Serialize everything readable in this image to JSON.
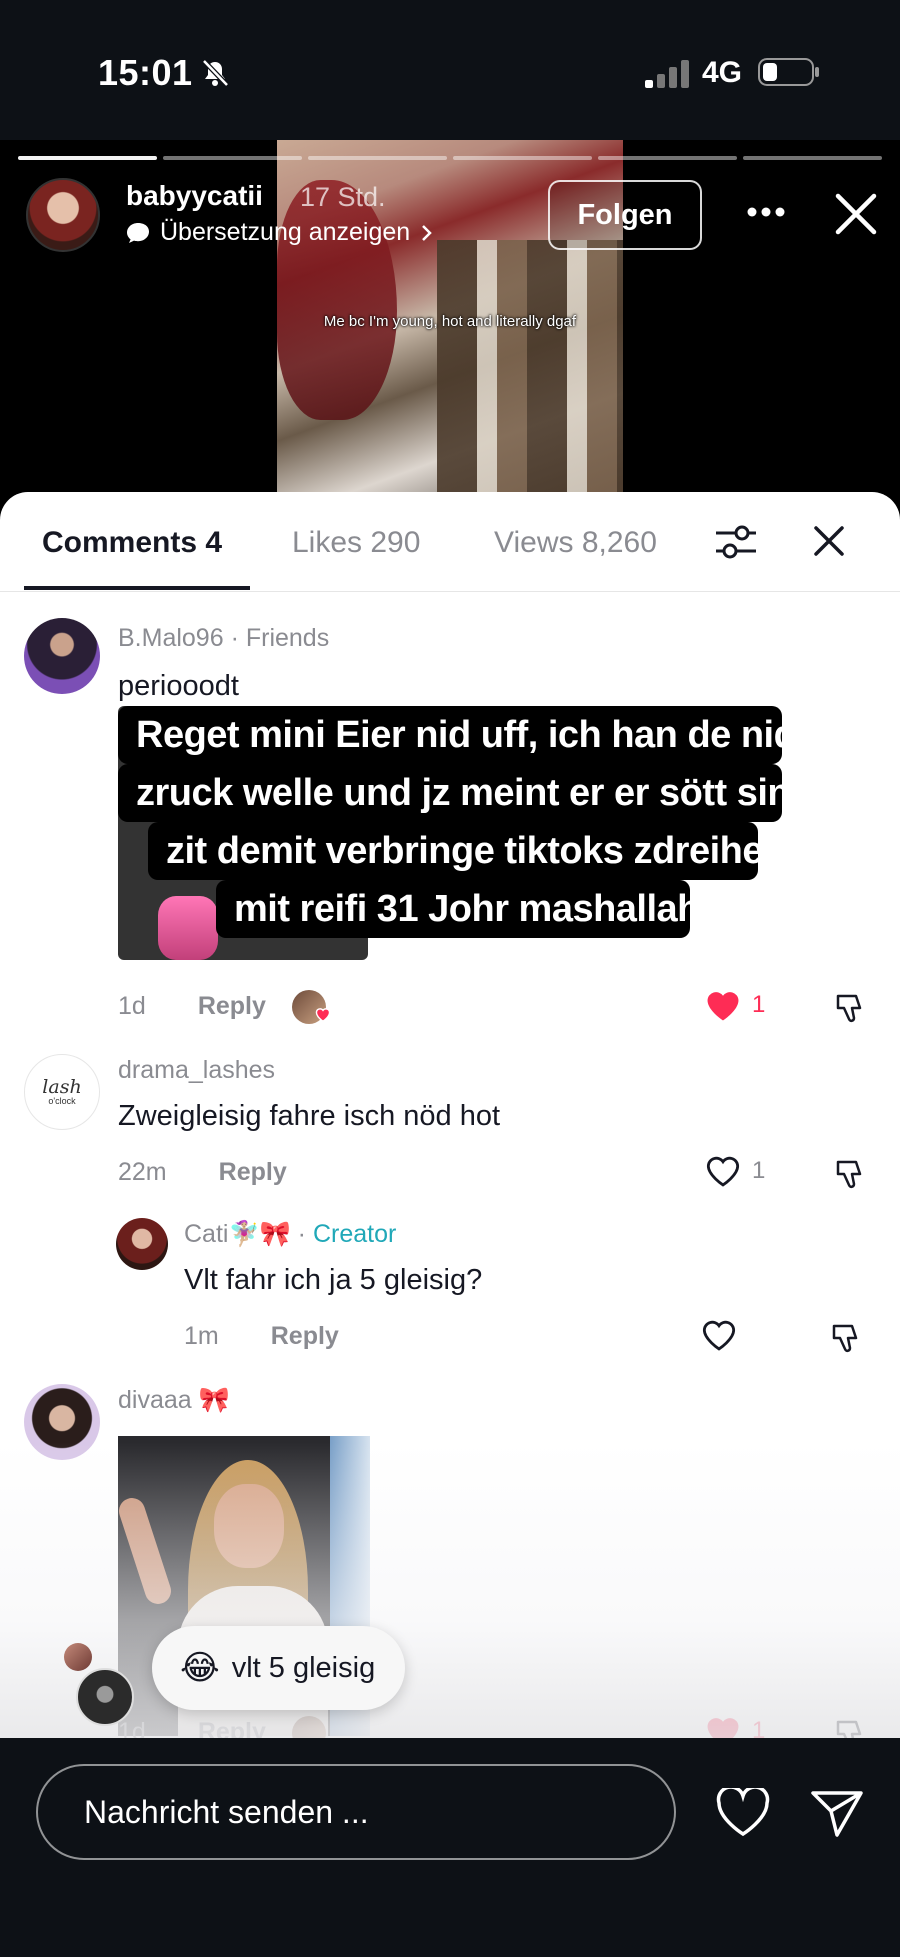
{
  "status_bar": {
    "time": "15:01",
    "network": "4G"
  },
  "story": {
    "username": "babyycatii",
    "time_ago": "17 Std.",
    "translate_label": "Übersetzung anzeigen",
    "follow_label": "Folgen",
    "caption": "Me bc I'm young, hot and literally dgaf",
    "progress_segments": 6,
    "progress_completed": 1
  },
  "sheet": {
    "tabs": [
      {
        "label": "Comments 4"
      },
      {
        "label": "Likes 290"
      },
      {
        "label": "Views 8,260"
      }
    ]
  },
  "comments": [
    {
      "user": "B.Malo96",
      "tag": "Friends",
      "text": "periooodt",
      "quote_lines": [
        "Reget mini Eier nid uff, ich han de nid",
        "zruck welle und jz meint er er sött sini",
        "zit demit verbringe tiktoks zdreihe",
        "mit reifi 31 Johr mashallah"
      ],
      "time": "1d",
      "reply_label": "Reply",
      "likes": "1",
      "liked": true
    },
    {
      "user": "drama_lashes",
      "text": "Zweigleisig fahre isch nöd hot",
      "time": "22m",
      "reply_label": "Reply",
      "likes": "1",
      "liked": false,
      "avatar_text_1": "lash",
      "avatar_text_2": "o'clock",
      "replies": [
        {
          "user": "Cati🧚🏼‍♀️🎀",
          "creator_label": "Creator",
          "text": "Vlt fahr ich ja 5 gleisig?",
          "time": "1m",
          "reply_label": "Reply"
        }
      ]
    },
    {
      "user": "divaaa 🎀",
      "time": "1d",
      "reply_label": "Reply",
      "likes": "1",
      "liked": true
    }
  ],
  "quick_reply": {
    "emoji": "😂",
    "text": "vlt 5 gleisig"
  },
  "bottom_bar": {
    "message_placeholder": "Nachricht senden ..."
  },
  "colors": {
    "like_red": "#fe2c55",
    "creator_teal": "#20a8b8",
    "sheet_bg": "#ffffff",
    "bar_bg": "#0d1116"
  },
  "icons": [
    "bell-muted-icon",
    "signal-icon",
    "battery-icon",
    "translate-bubble-icon",
    "chevron-right-icon",
    "more-icon",
    "close-icon",
    "filter-icon",
    "heart-icon",
    "dislike-icon",
    "send-icon"
  ]
}
